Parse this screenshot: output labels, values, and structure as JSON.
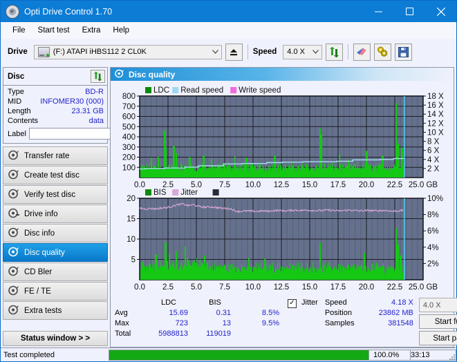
{
  "window": {
    "title": "Opti Drive Control 1.70",
    "icon": "disc-icon",
    "minimize": "minimize",
    "maximize": "maximize",
    "close": "close"
  },
  "menu": [
    "File",
    "Start test",
    "Extra",
    "Help"
  ],
  "toolbar": {
    "drive_label": "Drive",
    "drive_value": "(F:)  ATAPI iHBS112  2 CL0K",
    "eject_icon": "eject-icon",
    "speed_label": "Speed",
    "speed_value": "4.0 X",
    "refresh_icon": "refresh-icon",
    "erase_icon": "eraser-icon",
    "tools_icon": "tools-icon",
    "save_icon": "save-icon"
  },
  "disc": {
    "title": "Disc",
    "refresh_icon": "refresh-icon",
    "rows": [
      {
        "key": "Type",
        "value": "BD-R"
      },
      {
        "key": "MID",
        "value": "INFOMER30 (000)"
      },
      {
        "key": "Length",
        "value": "23.31 GB"
      },
      {
        "key": "Contents",
        "value": "data"
      }
    ],
    "label_key": "Label",
    "label_value": "",
    "label_placeholder": "",
    "disc_icon": "cd-icon"
  },
  "nav": {
    "items": [
      {
        "label": "Transfer rate",
        "icon": "disc-icon",
        "selected": false
      },
      {
        "label": "Create test disc",
        "icon": "disc-icon",
        "selected": false
      },
      {
        "label": "Verify test disc",
        "icon": "disc-icon",
        "selected": false
      },
      {
        "label": "Drive info",
        "icon": "disc-icon",
        "selected": false
      },
      {
        "label": "Disc info",
        "icon": "disc-icon",
        "selected": false
      },
      {
        "label": "Disc quality",
        "icon": "disc-icon",
        "selected": true
      },
      {
        "label": "CD Bler",
        "icon": "disc-icon",
        "selected": false
      },
      {
        "label": "FE / TE",
        "icon": "disc-icon",
        "selected": false
      },
      {
        "label": "Extra tests",
        "icon": "disc-icon",
        "selected": false
      }
    ],
    "status_window": "Status window > >"
  },
  "main": {
    "header_title": "Disc quality",
    "header_icon": "disc-icon"
  },
  "stats": {
    "columns": [
      "LDC",
      "BIS"
    ],
    "rows": [
      {
        "key": "Avg",
        "ldc": "15.69",
        "bis": "0.31",
        "jitter": "8.5%"
      },
      {
        "key": "Max",
        "ldc": "723",
        "bis": "13",
        "jitter": "9.5%"
      },
      {
        "key": "Total",
        "ldc": "5988813",
        "bis": "119019",
        "jitter": ""
      }
    ],
    "jitter_label": "Jitter",
    "jitter_checked": true,
    "speed_key": "Speed",
    "speed_value": "4.18 X",
    "position_key": "Position",
    "position_value": "23862 MB",
    "samples_key": "Samples",
    "samples_value": "381548",
    "speed_select": "4.0 X",
    "start_full": "Start full",
    "start_part": "Start part"
  },
  "statusbar": {
    "text": "Test completed",
    "percent_label": "100.0%",
    "percent_value": 100,
    "time": "33:13"
  },
  "chart_data": [
    {
      "type": "area",
      "id": "ldc-chart",
      "title": "",
      "legend": [
        {
          "name": "LDC",
          "color": "#0a8a0a"
        },
        {
          "name": "Read speed",
          "color": "#9fd8f2"
        },
        {
          "name": "Write speed",
          "color": "#f06bdc"
        }
      ],
      "legend_position": "top-left",
      "grid": true,
      "plot_bg": "#65718c",
      "xlabel": "GB",
      "x": [
        0.0,
        2.5,
        5.0,
        7.5,
        10.0,
        12.5,
        15.0,
        17.5,
        20.0,
        22.5,
        25.0
      ],
      "xlim": [
        0.0,
        25.0
      ],
      "ylabel_left": "",
      "ylim_left": [
        0,
        800
      ],
      "yticks_left": [
        100,
        200,
        300,
        400,
        500,
        600,
        700,
        800
      ],
      "ylabel_right": "X",
      "ylim_right": [
        0,
        18
      ],
      "yticks_right": [
        "2 X",
        "4 X",
        "6 X",
        "8 X",
        "10 X",
        "12 X",
        "14 X",
        "16 X",
        "18 X"
      ],
      "data_end_gb": 23.3,
      "series": [
        {
          "name": "LDC",
          "color": "#14c814",
          "baseline": 110,
          "noise": 55,
          "spikes": [
            {
              "x": 2.2,
              "y": 460
            },
            {
              "x": 2.3,
              "y": 300
            },
            {
              "x": 3.0,
              "y": 310
            },
            {
              "x": 3.2,
              "y": 240
            },
            {
              "x": 1.0,
              "y": 195
            },
            {
              "x": 1.6,
              "y": 205
            },
            {
              "x": 4.4,
              "y": 200
            },
            {
              "x": 5.6,
              "y": 215
            },
            {
              "x": 6.3,
              "y": 180
            },
            {
              "x": 8.4,
              "y": 205
            },
            {
              "x": 9.4,
              "y": 195
            },
            {
              "x": 11.9,
              "y": 215
            },
            {
              "x": 15.9,
              "y": 480
            },
            {
              "x": 16.0,
              "y": 420
            },
            {
              "x": 17.6,
              "y": 230
            },
            {
              "x": 18.4,
              "y": 175
            },
            {
              "x": 20.0,
              "y": 260
            },
            {
              "x": 21.4,
              "y": 215
            },
            {
              "x": 22.6,
              "y": 730
            },
            {
              "x": 22.75,
              "y": 330
            },
            {
              "x": 23.1,
              "y": 290
            }
          ]
        },
        {
          "name": "Read speed",
          "color": "#a8ddf5",
          "steps": [
            {
              "x": 0.0,
              "v": 1.9
            },
            {
              "x": 0.5,
              "v": 2.0
            },
            {
              "x": 2.2,
              "v": 2.1
            },
            {
              "x": 4.0,
              "v": 2.3
            },
            {
              "x": 5.2,
              "v": 2.6
            },
            {
              "x": 7.4,
              "v": 3.0
            },
            {
              "x": 9.0,
              "v": 3.1
            },
            {
              "x": 11.2,
              "v": 3.3
            },
            {
              "x": 12.6,
              "v": 3.4
            },
            {
              "x": 14.4,
              "v": 3.5
            },
            {
              "x": 17.4,
              "v": 3.6
            },
            {
              "x": 18.8,
              "v": 3.9
            },
            {
              "x": 21.2,
              "v": 4.0
            },
            {
              "x": 22.4,
              "v": 4.2
            },
            {
              "x": 23.3,
              "v": 4.2
            }
          ]
        }
      ],
      "markers": [
        {
          "x": 23.35,
          "color": "#4fc8f0",
          "label": "position-marker"
        }
      ]
    },
    {
      "type": "area",
      "id": "bis-chart",
      "title": "",
      "legend": [
        {
          "name": "BIS",
          "color": "#0a8a0a"
        },
        {
          "name": "Jitter",
          "color": "#d8a8d8"
        },
        {
          "name": "",
          "color": "#2a2a3a"
        }
      ],
      "legend_position": "top-left",
      "grid": true,
      "plot_bg": "#65718c",
      "xlabel": "GB",
      "x": [
        0.0,
        2.5,
        5.0,
        7.5,
        10.0,
        12.5,
        15.0,
        17.5,
        20.0,
        22.5,
        25.0
      ],
      "xlim": [
        0.0,
        25.0
      ],
      "ylim_left": [
        0,
        20
      ],
      "yticks_left": [
        5,
        10,
        15,
        20
      ],
      "ylim_right": [
        0,
        10
      ],
      "yticks_right": [
        "2%",
        "4%",
        "6%",
        "8%",
        "10%"
      ],
      "data_end_gb": 23.3,
      "series": [
        {
          "name": "BIS",
          "color": "#14c814",
          "baseline_before": 4.3,
          "baseline_after": 3.3,
          "break_x": 6.0,
          "noise": 1.6,
          "spikes": [
            {
              "x": 2.25,
              "y": 9.2
            },
            {
              "x": 4.0,
              "y": 8.2
            },
            {
              "x": 3.2,
              "y": 7.0
            },
            {
              "x": 1.4,
              "y": 6.3
            },
            {
              "x": 2.6,
              "y": 6.4
            },
            {
              "x": 5.7,
              "y": 6.0
            },
            {
              "x": 9.6,
              "y": 5.4
            },
            {
              "x": 11.0,
              "y": 5.2
            },
            {
              "x": 15.9,
              "y": 9.1
            },
            {
              "x": 19.8,
              "y": 6.6
            },
            {
              "x": 22.6,
              "y": 12.6
            },
            {
              "x": 22.75,
              "y": 8.6
            },
            {
              "x": 23.0,
              "y": 6.0
            }
          ]
        },
        {
          "name": "Jitter",
          "color": "#dca8dc",
          "unit": "%",
          "values_pct": [
            8.8,
            8.7,
            8.75,
            8.7,
            8.8,
            8.85,
            9.0,
            9.2,
            9.3,
            9.1,
            9.2,
            9.0,
            8.9,
            8.95,
            8.9,
            8.8,
            8.75,
            8.7,
            8.4,
            8.4,
            8.45,
            8.4,
            8.4,
            8.45,
            8.4,
            8.5,
            8.5,
            8.45,
            8.5,
            8.55,
            8.5,
            8.55,
            8.5,
            8.5,
            8.5,
            8.55,
            8.5,
            8.45,
            8.5,
            8.55,
            8.5,
            8.45,
            8.5,
            8.5,
            8.45,
            8.5,
            8.5,
            8.4,
            8.45,
            8.5
          ]
        }
      ],
      "markers": [
        {
          "x": 23.35,
          "color": "#4fc8f0",
          "label": "position-marker"
        }
      ]
    }
  ]
}
